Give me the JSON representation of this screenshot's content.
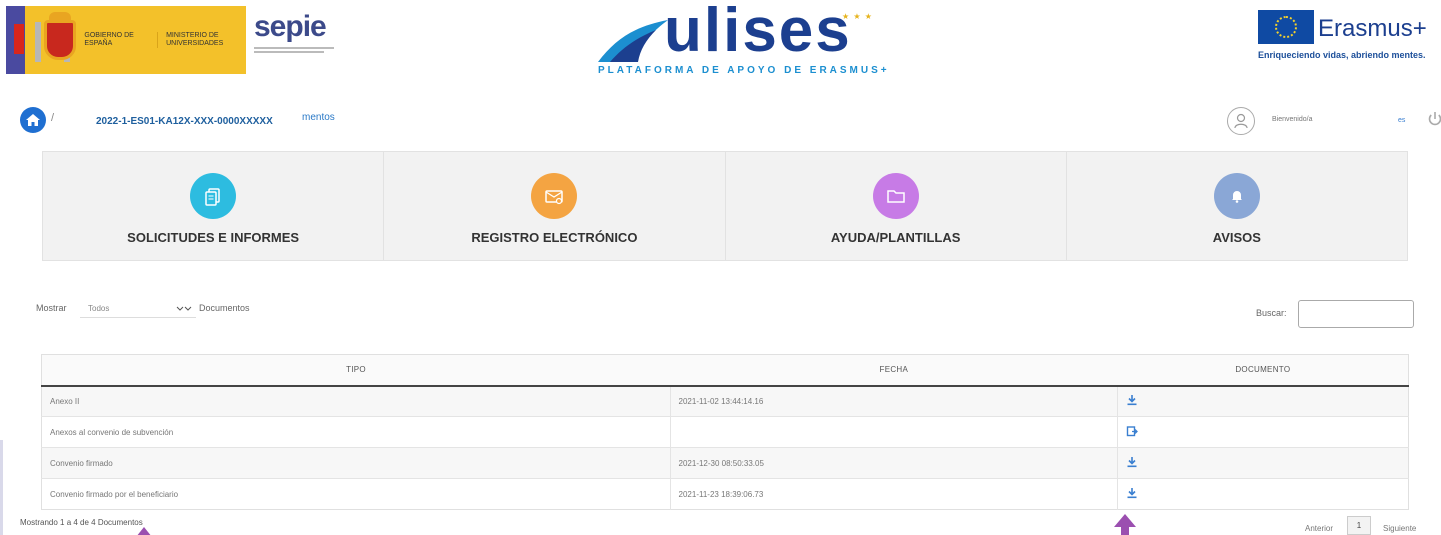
{
  "header": {
    "gov_line1": "Gobierno de España",
    "gov_line2": "Ministerio de Universidades",
    "sepie_word": "sepie",
    "ulises_word": "ulises",
    "ulises_sub": "PLATAFORMA DE APOYO DE ERASMUS+",
    "erasmus_word": "Erasmus+",
    "erasmus_sub": "Enriqueciendo vidas, abriendo mentes."
  },
  "breadcrumb": {
    "separator": "/",
    "project": "2022-1-ES01-KA12X-XXX-0000XXXXX",
    "tail": "mentos"
  },
  "user": {
    "welcome": "Bienvenido/a",
    "lang": "es"
  },
  "tiles": [
    {
      "label": "SOLICITUDES E INFORMES",
      "color": "#2dbce0"
    },
    {
      "label": "REGISTRO ELECTRÓNICO",
      "color": "#f4a442"
    },
    {
      "label": "AYUDA/PLANTILLAS",
      "color": "#c77be6"
    },
    {
      "label": "AVISOS",
      "color": "#8aa7d6"
    }
  ],
  "controls": {
    "show_label": "Mostrar",
    "show_value": "Todos",
    "show_suffix": "Documentos",
    "search_label": "Buscar:",
    "search_value": ""
  },
  "table": {
    "headers": [
      "TIPO",
      "FECHA",
      "DOCUMENTO"
    ],
    "rows": [
      {
        "tipo": "Anexo II",
        "fecha": "2021-11-02 13:44:14.16",
        "icon": "download-icon"
      },
      {
        "tipo": "Anexos al convenio de subvención",
        "fecha": "",
        "icon": "upload-icon"
      },
      {
        "tipo": "Convenio firmado",
        "fecha": "2021-12-30 08:50:33.05",
        "icon": "download-icon"
      },
      {
        "tipo": "Convenio firmado por el beneficiario",
        "fecha": "2021-11-23 18:39:06.73",
        "icon": "download-icon"
      }
    ]
  },
  "footer": {
    "info": "Mostrando 1 a 4 de 4 Documentos",
    "prev": "Anterior",
    "page": "1",
    "next": "Siguiente"
  },
  "colors": {
    "accent": "#1f6fd1",
    "icon_blue": "#3a7fd0",
    "arrow": "#9b4fb0"
  }
}
